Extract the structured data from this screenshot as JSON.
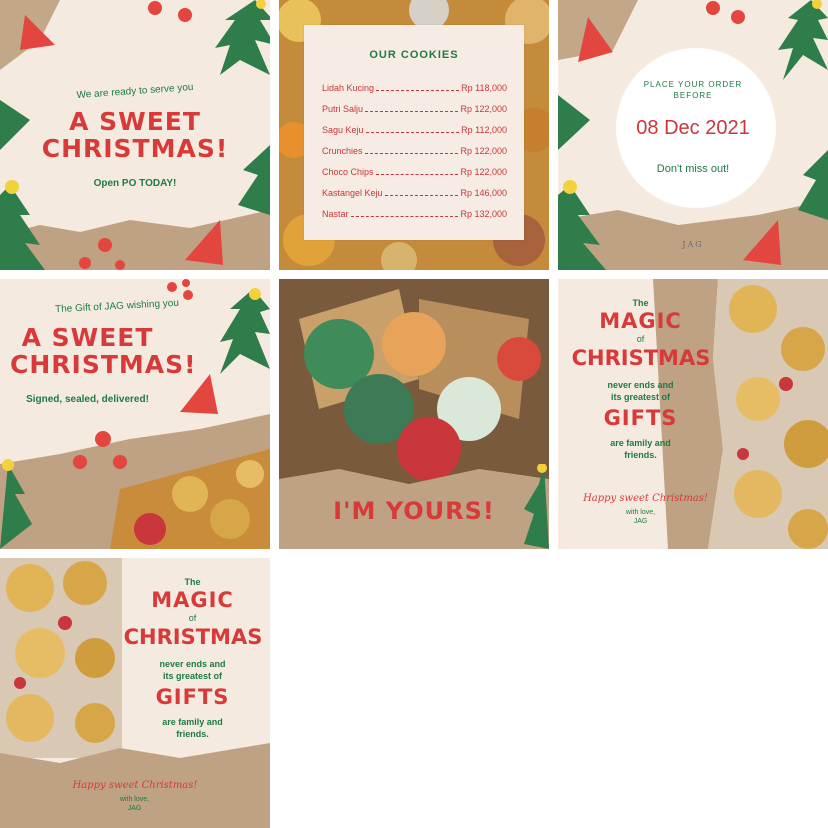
{
  "tiles": {
    "t1": {
      "tagline": "We are ready to serve you",
      "title": "A SWEET CHRISTMAS!",
      "cta": "Open PO TODAY!"
    },
    "t2": {
      "heading": "OUR COOKIES",
      "items": [
        {
          "name": "Lidah Kucing",
          "price": "Rp 118,000"
        },
        {
          "name": "Putri Salju",
          "price": "Rp 122,000"
        },
        {
          "name": "Sagu Keju",
          "price": "Rp 112,000"
        },
        {
          "name": "Crunchies",
          "price": "Rp 122,000"
        },
        {
          "name": "Choco Chips",
          "price": "Rp 122,000"
        },
        {
          "name": "Kastangel Keju",
          "price": "Rp 146,000"
        },
        {
          "name": "Nastar",
          "price": "Rp 132,000"
        }
      ]
    },
    "t3": {
      "line1": "PLACE YOUR ORDER",
      "line2": "BEFORE",
      "date": "08 Dec 2021",
      "note": "Don't miss out!",
      "brand": "JAG"
    },
    "t4": {
      "tagline": "The Gift of JAG wishing you",
      "title": "A SWEET CHRISTMAS!",
      "sub": "Signed, sealed, delivered!"
    },
    "t5": {
      "caption": "I'M YOURS!"
    },
    "t6": {
      "the": "The",
      "magic": "MAGIC",
      "of": "of",
      "christmas": "CHRISTMAS",
      "line1": "never ends and",
      "line2": "its greatest of",
      "gifts": "GIFTS",
      "line3": "are family and",
      "line4": "friends.",
      "happy": "Happy sweet Christmas!",
      "love": "with love,",
      "brand": "JAG"
    },
    "t7": {
      "the": "The",
      "magic": "MAGIC",
      "of": "of",
      "christmas": "CHRISTMAS",
      "line1": "never ends and",
      "line2": "its greatest of",
      "gifts": "GIFTS",
      "line3": "are family and",
      "line4": "friends.",
      "happy": "Happy sweet Christmas!",
      "love": "with love,",
      "brand": "JAG"
    }
  },
  "colors": {
    "red": "#d83a3a",
    "green": "#1f7a45",
    "cream": "#f5eadf",
    "kraft": "#b99c7c"
  },
  "icons": [
    "christmas-tree-icon",
    "ornament-icon",
    "gift-bow-icon",
    "cookie-jar-icon"
  ]
}
